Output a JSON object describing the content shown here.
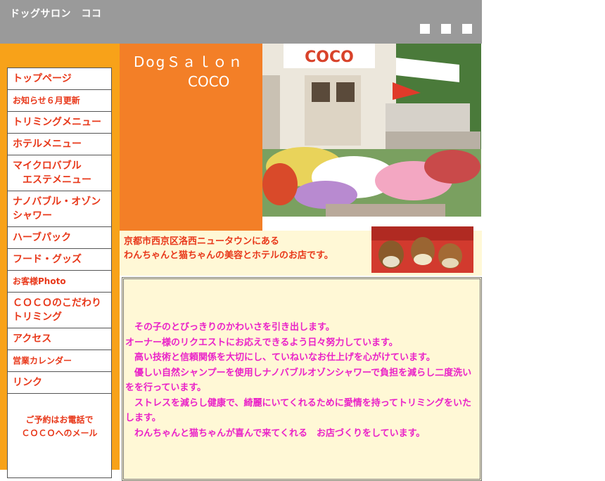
{
  "header": {
    "site_title": "ドッグサロン　ココ"
  },
  "nav": [
    {
      "label": "トップページ"
    },
    {
      "label": "お知らせ６月更新"
    },
    {
      "label": "トリミングメニュー"
    },
    {
      "label": "ホテルメニュー"
    },
    {
      "line1": "マイクロバブル",
      "line2": "エステメニュー"
    },
    {
      "label": "ナノバブル・オゾンシャワー"
    },
    {
      "label": "ハーブパック"
    },
    {
      "label": "フード・グッズ"
    },
    {
      "label": "お客様Photo"
    },
    {
      "label": "ＣＯＣＯのこだわりトリミング"
    },
    {
      "label": "アクセス"
    },
    {
      "label": "営業カレンダー"
    },
    {
      "label": "リンク"
    }
  ],
  "nav_footer": {
    "line1": "ご予約はお電話で",
    "line2": "ＣＯＣＯへのメール"
  },
  "brand": {
    "line1": "DogＳａｌｏｎ",
    "line2": "COCO"
  },
  "photo": {
    "sign_text": "COCO"
  },
  "info": {
    "line1": "京都市西京区洛西ニュータウンにある",
    "line2": "わんちゃんと猫ちゃんの美容とホテルのお店です。"
  },
  "main_message": [
    "　その子のとびっきりのかわいさを引き出します。",
    "オーナー様のリクエストにお応えできるよう日々努力しています。",
    "　高い技術と信頼関係を大切にし、ていねいなお仕上げを心がけています。",
    "　優しい自然シャンプーを使用しナノバブルオゾンシャワーで負担を減らし二度洗いをを行っています。",
    "　ストレスを減らし健康で、綺麗にいてくれるために愛情を持ってトリミングをいたします。",
    "　わんちゃんと猫ちゃんが喜んで来てくれる　お店づくりをしています。"
  ],
  "colors": {
    "header_gray": "#9a9a9a",
    "sidebar_orange": "#f8a219",
    "brand_orange": "#f37f27",
    "nav_text_red": "#e8381a",
    "message_magenta": "#ea22c8",
    "cream_bg": "#fff8d6"
  }
}
